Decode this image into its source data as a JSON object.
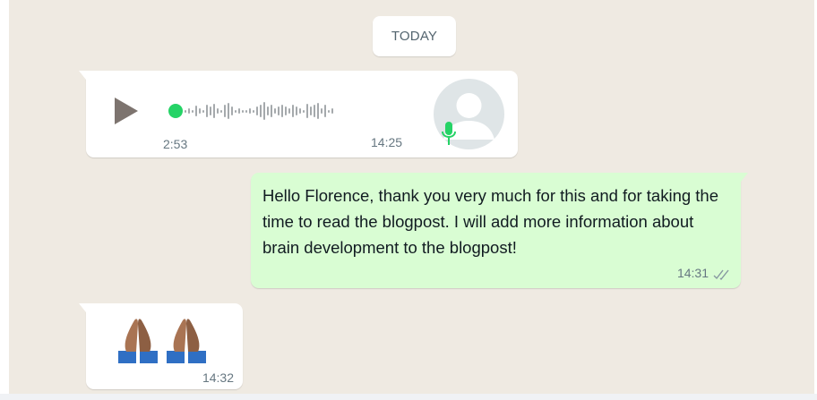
{
  "colors": {
    "chat_background": "#efeae2",
    "incoming_bubble": "#ffffff",
    "outgoing_bubble": "#d9fdd3",
    "accent_green": "#25d366",
    "meta_text": "#667781"
  },
  "date_divider": {
    "label": "TODAY"
  },
  "messages": [
    {
      "type": "voice",
      "direction": "incoming",
      "duration": "2:53",
      "time": "14:25",
      "icons": [
        "play-icon",
        "waveform-icon",
        "default-avatar-icon",
        "microphone-icon"
      ]
    },
    {
      "type": "text",
      "direction": "outgoing",
      "text": "Hello Florence, thank you very much for this and for taking the time to read the blogpost. I will add more information about brain development to the blogpost!",
      "time": "14:31",
      "status_icon": "double-check-icon"
    },
    {
      "type": "emoji",
      "direction": "incoming",
      "content": "🙏🙏",
      "time": "14:32"
    }
  ]
}
